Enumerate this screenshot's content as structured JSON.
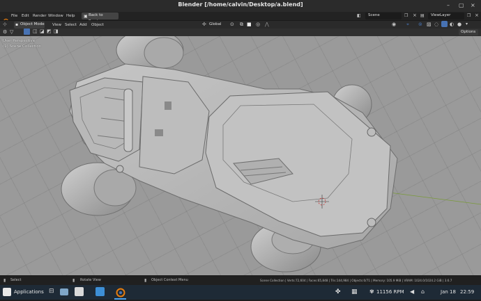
{
  "window": {
    "title": "Blender [/home/calvin/Desktop/a.blend]",
    "controls": [
      "–",
      "▢",
      "×"
    ]
  },
  "menubar": {
    "items": [
      "File",
      "Edit",
      "Render",
      "Window",
      "Help"
    ],
    "back_button": "Back to Previous",
    "scene_label": "Scene",
    "viewlayer_label": "ViewLayer"
  },
  "header": {
    "mode": "Object Mode",
    "menus": [
      "View",
      "Select",
      "Add",
      "Object"
    ],
    "transform_orientation": "Global",
    "options": "Options"
  },
  "viewport": {
    "perspective_label": "User Perspective",
    "collection_label": "(1) Scene Collection"
  },
  "statusbar": {
    "select": "Select",
    "rotate": "Rotate View",
    "context": "Object Context Menu",
    "stats": "Scene Collection | Verts:72,604 | Faces:65,848 | Tris:144,984 | Objects:0/71 | Memory: 105.9 MiB | VRAM: 1024.0/1024.2 GiB | 3.6.7"
  },
  "taskbar": {
    "apps_label": "Applications",
    "fan": "11156 RPM",
    "date": "Jan 18",
    "time": "22:59"
  },
  "colors": {
    "title_bg": "#2b2b2b",
    "viewport_bg": "#9a9a9a",
    "taskbar_bg": "#1e2a36",
    "accent": "#4772b3"
  }
}
